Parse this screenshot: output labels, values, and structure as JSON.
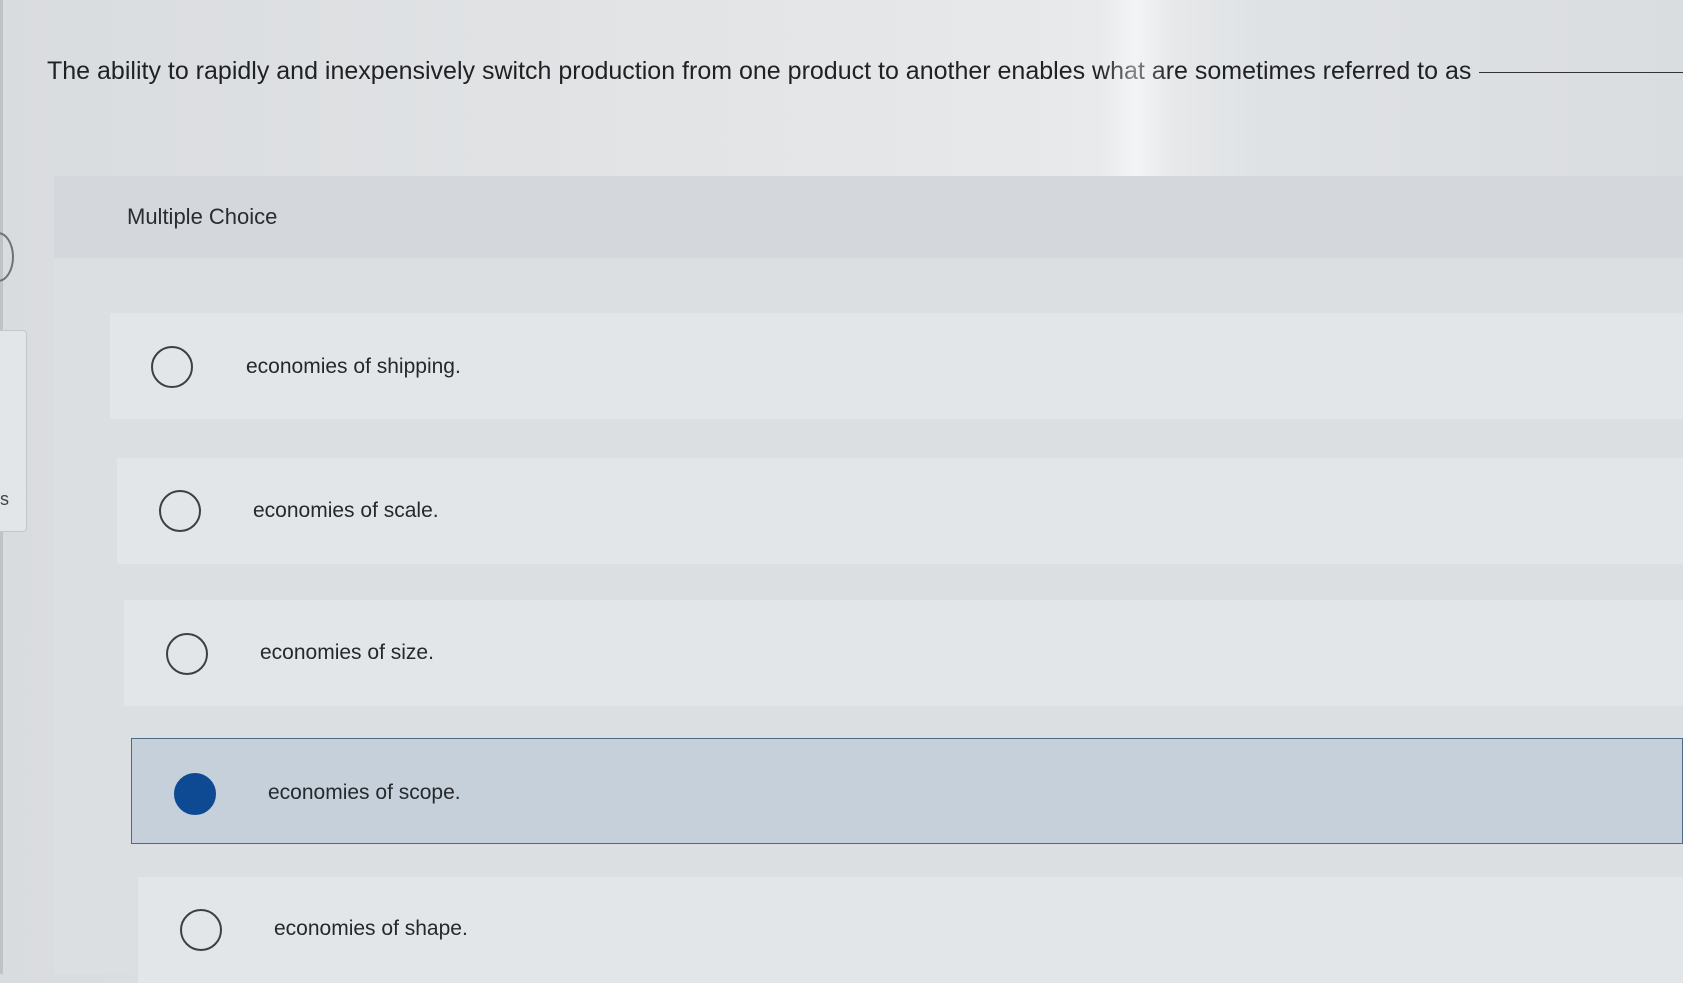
{
  "question": {
    "text": "The ability to rapidly and inexpensively switch production from one product to another enables what are sometimes referred to as"
  },
  "multiple_choice": {
    "label": "Multiple Choice",
    "options": [
      {
        "label": "economies of shipping.",
        "selected": false
      },
      {
        "label": "economies of scale.",
        "selected": false
      },
      {
        "label": "economies of size.",
        "selected": false
      },
      {
        "label": "economies of scope.",
        "selected": true
      },
      {
        "label": "economies of shape.",
        "selected": false
      }
    ]
  },
  "side": {
    "letter": "s"
  },
  "colors": {
    "selected_fill": "#0e4a94",
    "selected_background": "#c5d0da"
  }
}
